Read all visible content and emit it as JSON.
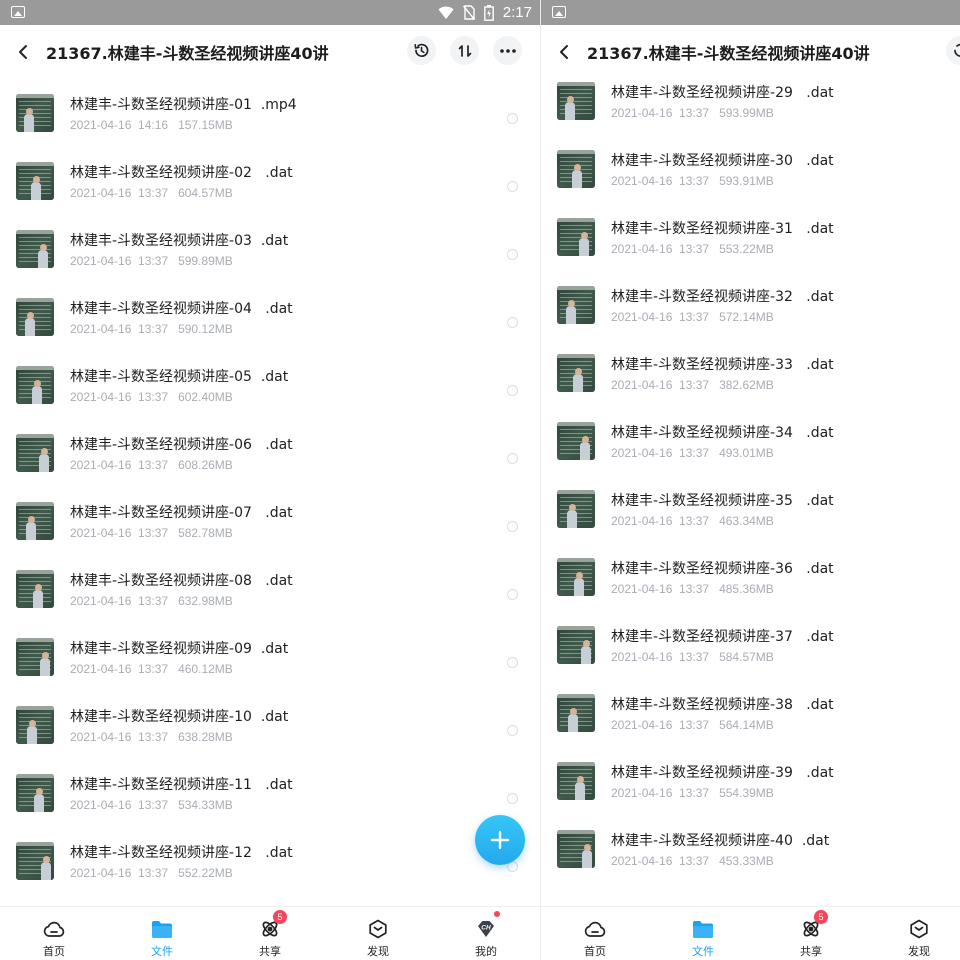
{
  "left": {
    "status": {
      "time": "2:17"
    },
    "header": {
      "title": "21367.林建丰-斗数圣经视频讲座40讲"
    },
    "files": [
      {
        "name": "林建丰-斗数圣经视频讲座-01  .mp4",
        "meta": "2021-04-16  14:16   157.15MB"
      },
      {
        "name": "林建丰-斗数圣经视频讲座-02   .dat",
        "meta": "2021-04-16  13:37   604.57MB"
      },
      {
        "name": "林建丰-斗数圣经视频讲座-03  .dat",
        "meta": "2021-04-16  13:37   599.89MB"
      },
      {
        "name": "林建丰-斗数圣经视频讲座-04   .dat",
        "meta": "2021-04-16  13:37   590.12MB"
      },
      {
        "name": "林建丰-斗数圣经视频讲座-05  .dat",
        "meta": "2021-04-16  13:37   602.40MB"
      },
      {
        "name": "林建丰-斗数圣经视频讲座-06   .dat",
        "meta": "2021-04-16  13:37   608.26MB"
      },
      {
        "name": "林建丰-斗数圣经视频讲座-07   .dat",
        "meta": "2021-04-16  13:37   582.78MB"
      },
      {
        "name": "林建丰-斗数圣经视频讲座-08   .dat",
        "meta": "2021-04-16  13:37   632.98MB"
      },
      {
        "name": "林建丰-斗数圣经视频讲座-09  .dat",
        "meta": "2021-04-16  13:37   460.12MB"
      },
      {
        "name": "林建丰-斗数圣经视频讲座-10  .dat",
        "meta": "2021-04-16  13:37   638.28MB"
      },
      {
        "name": "林建丰-斗数圣经视频讲座-11   .dat",
        "meta": "2021-04-16  13:37   534.33MB"
      },
      {
        "name": "林建丰-斗数圣经视频讲座-12   .dat",
        "meta": "2021-04-16  13:37   552.22MB"
      }
    ],
    "nav": [
      {
        "label": "首页",
        "icon": "home-cloud-icon"
      },
      {
        "label": "文件",
        "icon": "folder-icon",
        "active": true
      },
      {
        "label": "共享",
        "icon": "share-icon",
        "badge": "5"
      },
      {
        "label": "发现",
        "icon": "discover-icon"
      },
      {
        "label": "我的",
        "icon": "profile-icon"
      }
    ]
  },
  "right": {
    "header": {
      "title": "21367.林建丰-斗数圣经视频讲座40讲"
    },
    "files": [
      {
        "name": "林建丰-斗数圣经视频讲座-29   .dat",
        "meta": "2021-04-16  13:37   593.99MB"
      },
      {
        "name": "林建丰-斗数圣经视频讲座-30   .dat",
        "meta": "2021-04-16  13:37   593.91MB"
      },
      {
        "name": "林建丰-斗数圣经视频讲座-31   .dat",
        "meta": "2021-04-16  13:37   553.22MB"
      },
      {
        "name": "林建丰-斗数圣经视频讲座-32   .dat",
        "meta": "2021-04-16  13:37   572.14MB"
      },
      {
        "name": "林建丰-斗数圣经视频讲座-33   .dat",
        "meta": "2021-04-16  13:37   382.62MB"
      },
      {
        "name": "林建丰-斗数圣经视频讲座-34   .dat",
        "meta": "2021-04-16  13:37   493.01MB"
      },
      {
        "name": "林建丰-斗数圣经视频讲座-35   .dat",
        "meta": "2021-04-16  13:37   463.34MB"
      },
      {
        "name": "林建丰-斗数圣经视频讲座-36   .dat",
        "meta": "2021-04-16  13:37   485.36MB"
      },
      {
        "name": "林建丰-斗数圣经视频讲座-37   .dat",
        "meta": "2021-04-16  13:37   584.57MB"
      },
      {
        "name": "林建丰-斗数圣经视频讲座-38   .dat",
        "meta": "2021-04-16  13:37   564.14MB"
      },
      {
        "name": "林建丰-斗数圣经视频讲座-39   .dat",
        "meta": "2021-04-16  13:37   554.39MB"
      },
      {
        "name": "林建丰-斗数圣经视频讲座-40  .dat",
        "meta": "2021-04-16  13:37   453.33MB"
      }
    ],
    "nav": [
      {
        "label": "首页",
        "icon": "home-cloud-icon"
      },
      {
        "label": "文件",
        "icon": "folder-icon",
        "active": true
      },
      {
        "label": "共享",
        "icon": "share-icon",
        "badge": "5"
      },
      {
        "label": "发现",
        "icon": "discover-icon"
      }
    ]
  },
  "colors": {
    "accent": "#1ba1f0",
    "badge": "#f5455c",
    "meta_text": "#a9adb3",
    "status_bar": "#9a9a9a"
  }
}
